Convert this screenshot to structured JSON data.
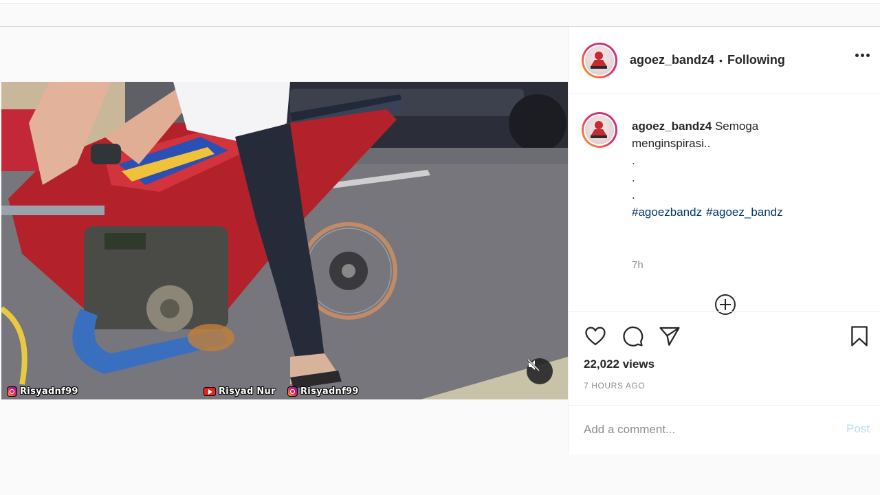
{
  "post": {
    "username": "agoez_bandz4",
    "separator": "•",
    "follow_status": "Following",
    "caption": {
      "username": "agoez_bandz4",
      "text_line1": "Semoga",
      "text_line2": "menginspirasi..",
      "dot_lines": [
        ".",
        ".",
        "."
      ],
      "hashtags": [
        "#agoezbandz",
        "#agoez_bandz"
      ],
      "time": "7h"
    },
    "views": "22,022 views",
    "posted_ago": "7 HOURS AGO",
    "comment_placeholder": "Add a comment...",
    "post_button_label": "Post"
  },
  "video": {
    "watermarks": [
      {
        "icon": "instagram-icon",
        "text": "Risyadnf99"
      },
      {
        "icon": "youtube-icon",
        "text": "Risyad Nur"
      },
      {
        "icon": "instagram-icon",
        "text": "Risyadnf99"
      }
    ],
    "muted": true
  },
  "icons": {
    "more": "more-options-icon",
    "load_more": "plus-circle-icon",
    "like": "heart-icon",
    "comment": "comment-icon",
    "share": "paper-plane-icon",
    "save": "bookmark-icon",
    "mute": "speaker-muted-icon"
  },
  "colors": {
    "link": "#00376b",
    "secondary_text": "#8e8e8e",
    "post_button_disabled": "#b2dffc",
    "primary_text": "#262626"
  }
}
